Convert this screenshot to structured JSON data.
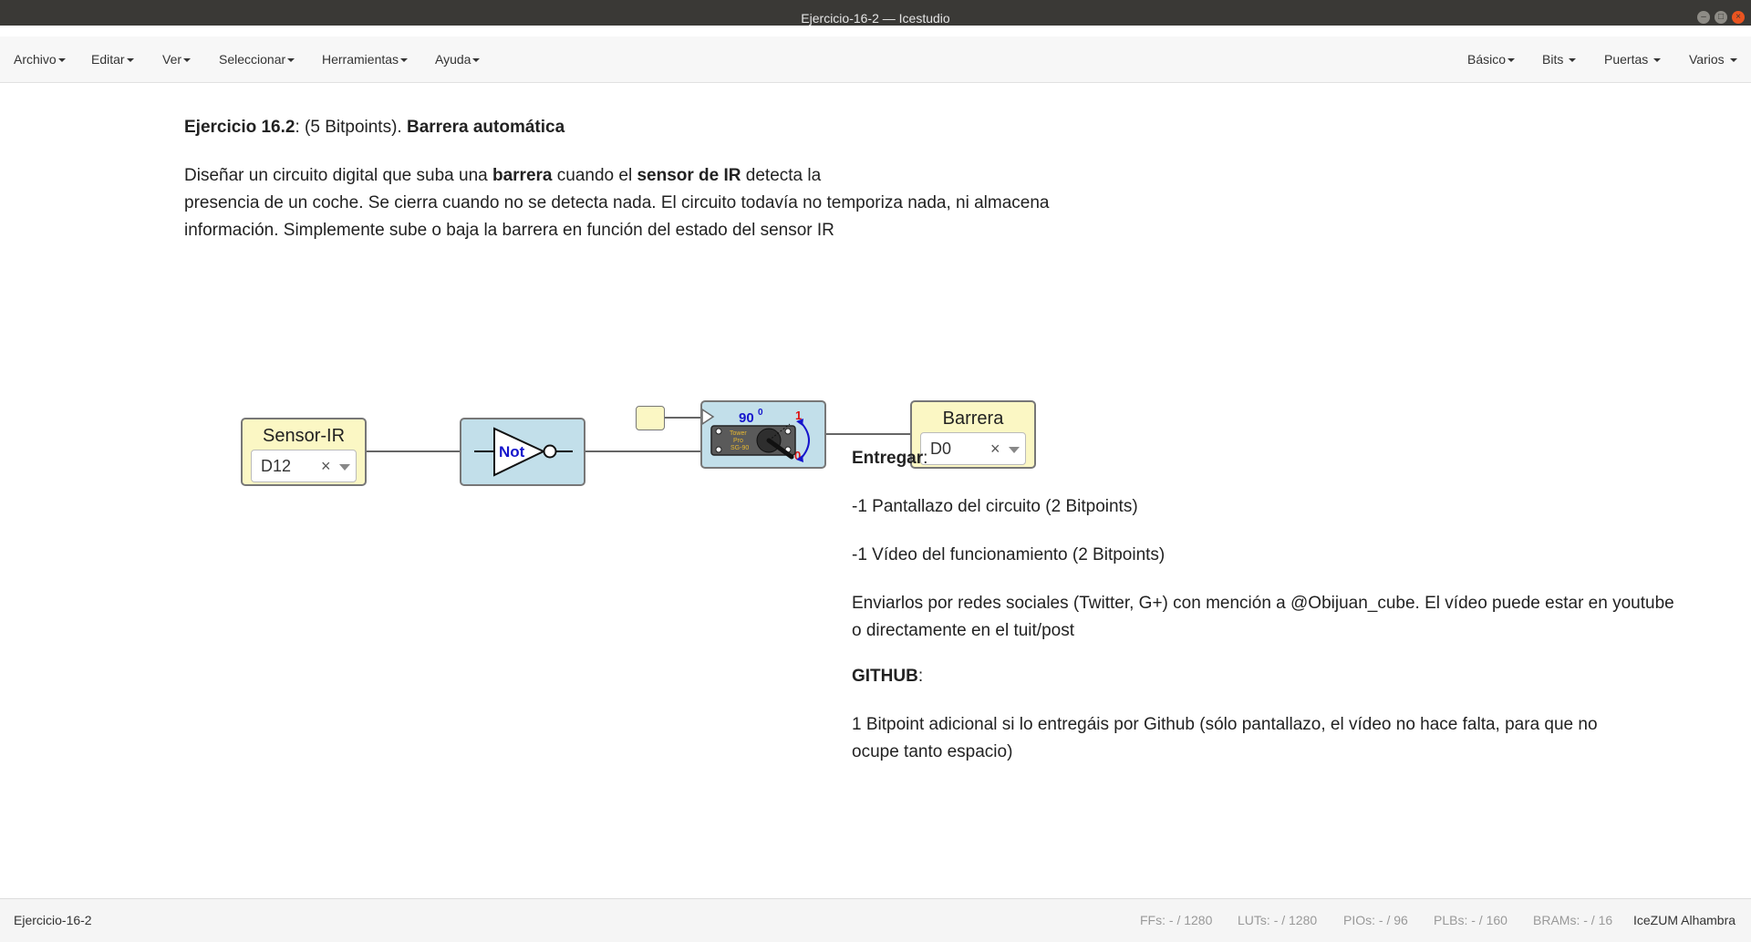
{
  "window": {
    "title": "Ejercicio-16-2 — Icestudio"
  },
  "menu_left": [
    {
      "label": "Archivo"
    },
    {
      "label": "Editar"
    },
    {
      "label": "Ver"
    },
    {
      "label": "Seleccionar"
    },
    {
      "label": "Herramientas"
    },
    {
      "label": "Ayuda"
    }
  ],
  "menu_right": [
    {
      "label": "Básico"
    },
    {
      "label": "Bits"
    },
    {
      "label": "Puertas"
    },
    {
      "label": "Varios"
    }
  ],
  "header_note": {
    "exercise": "Ejercicio 16.2",
    "points": ": (5 Bitpoints). ",
    "title": "Barrera automática"
  },
  "description": {
    "p1_a": "Diseñar un circuito digital que suba una ",
    "p1_b": "barrera",
    "p1_c": " cuando el ",
    "p1_d": "sensor de IR",
    "p1_e": " detecta la",
    "line2": "presencia de un coche. Se cierra cuando no se detecta nada. El circuito todavía no temporiza nada, ni almacena",
    "line3": "información. Simplemente sube o baja la barrera en función del estado del sensor IR"
  },
  "blocks": {
    "input": {
      "name": "Sensor-IR",
      "pin": "D12",
      "clear": "×"
    },
    "not_gate": {
      "label": "Not"
    },
    "servo": {
      "angle": "90",
      "degree": "0",
      "one": "1",
      "zero": "0",
      "brand1": "Tower",
      "brand2": "Pro",
      "model": "SG-90"
    },
    "output": {
      "name": "Barrera",
      "pin": "D0",
      "clear": "×"
    }
  },
  "deliver_note": {
    "heading": "Entregar",
    "item1": "-1 Pantallazo del circuito (2 Bitpoints)",
    "item2": "-1 Vídeo del funcionamiento (2 Bitpoints)",
    "send1": "Enviarlos por redes sociales (Twitter, G+) con mención a @Obijuan_cube. El vídeo puede estar en youtube",
    "send2": "o directamente en el tuit/post",
    "github_heading": "GITHUB",
    "github1": "1 Bitpoint adicional si lo entregáis por Github (sólo pantallazo, el vídeo no hace falta, para que no",
    "github2": "ocupe tanto espacio)"
  },
  "status": {
    "filename": "Ejercicio-16-2",
    "ffs_label": "FFs:",
    "ffs_value": "- / 1280",
    "luts_label": "LUTs:",
    "luts_value": "- / 1280",
    "pios_label": "PIOs:",
    "pios_value": "- / 96",
    "plbs_label": "PLBs:",
    "plbs_value": "- / 160",
    "brams_label": "BRAMs:",
    "brams_value": "- / 16",
    "board": "IceZUM Alhambra"
  }
}
